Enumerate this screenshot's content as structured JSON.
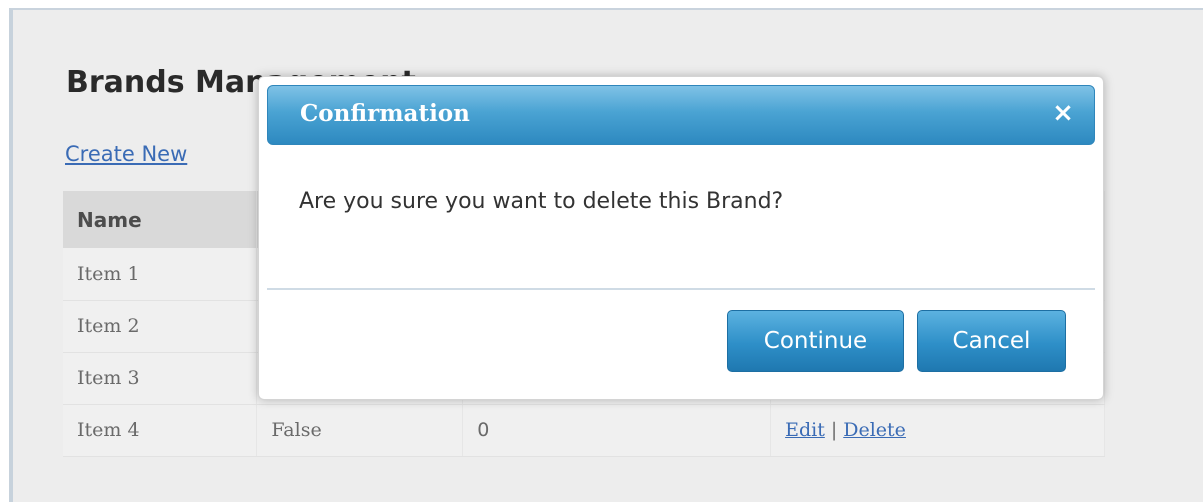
{
  "page": {
    "title": "Brands Management",
    "create_link": "Create New"
  },
  "table": {
    "headers": [
      "Name",
      "",
      "",
      ""
    ],
    "rows": [
      {
        "name": "Item 1",
        "col2": "",
        "col3": "",
        "edit": "",
        "delete": ""
      },
      {
        "name": "Item 2",
        "col2": "",
        "col3": "",
        "edit": "",
        "delete": ""
      },
      {
        "name": "Item 3",
        "col2": "",
        "col3": "",
        "edit": "",
        "delete": ""
      },
      {
        "name": "Item 4",
        "col2": "False",
        "col3": "0",
        "edit": "Edit",
        "sep": "|",
        "delete": "Delete"
      }
    ]
  },
  "dialog": {
    "title": "Confirmation",
    "close_icon": "close-icon",
    "close_glyph": "×",
    "message": "Are you sure you want to delete this Brand?",
    "continue_label": "Continue",
    "cancel_label": "Cancel"
  },
  "colors": {
    "dialog_header": "#3a9ad0",
    "button": "#2e8fc8",
    "link": "#3a6bb5"
  }
}
